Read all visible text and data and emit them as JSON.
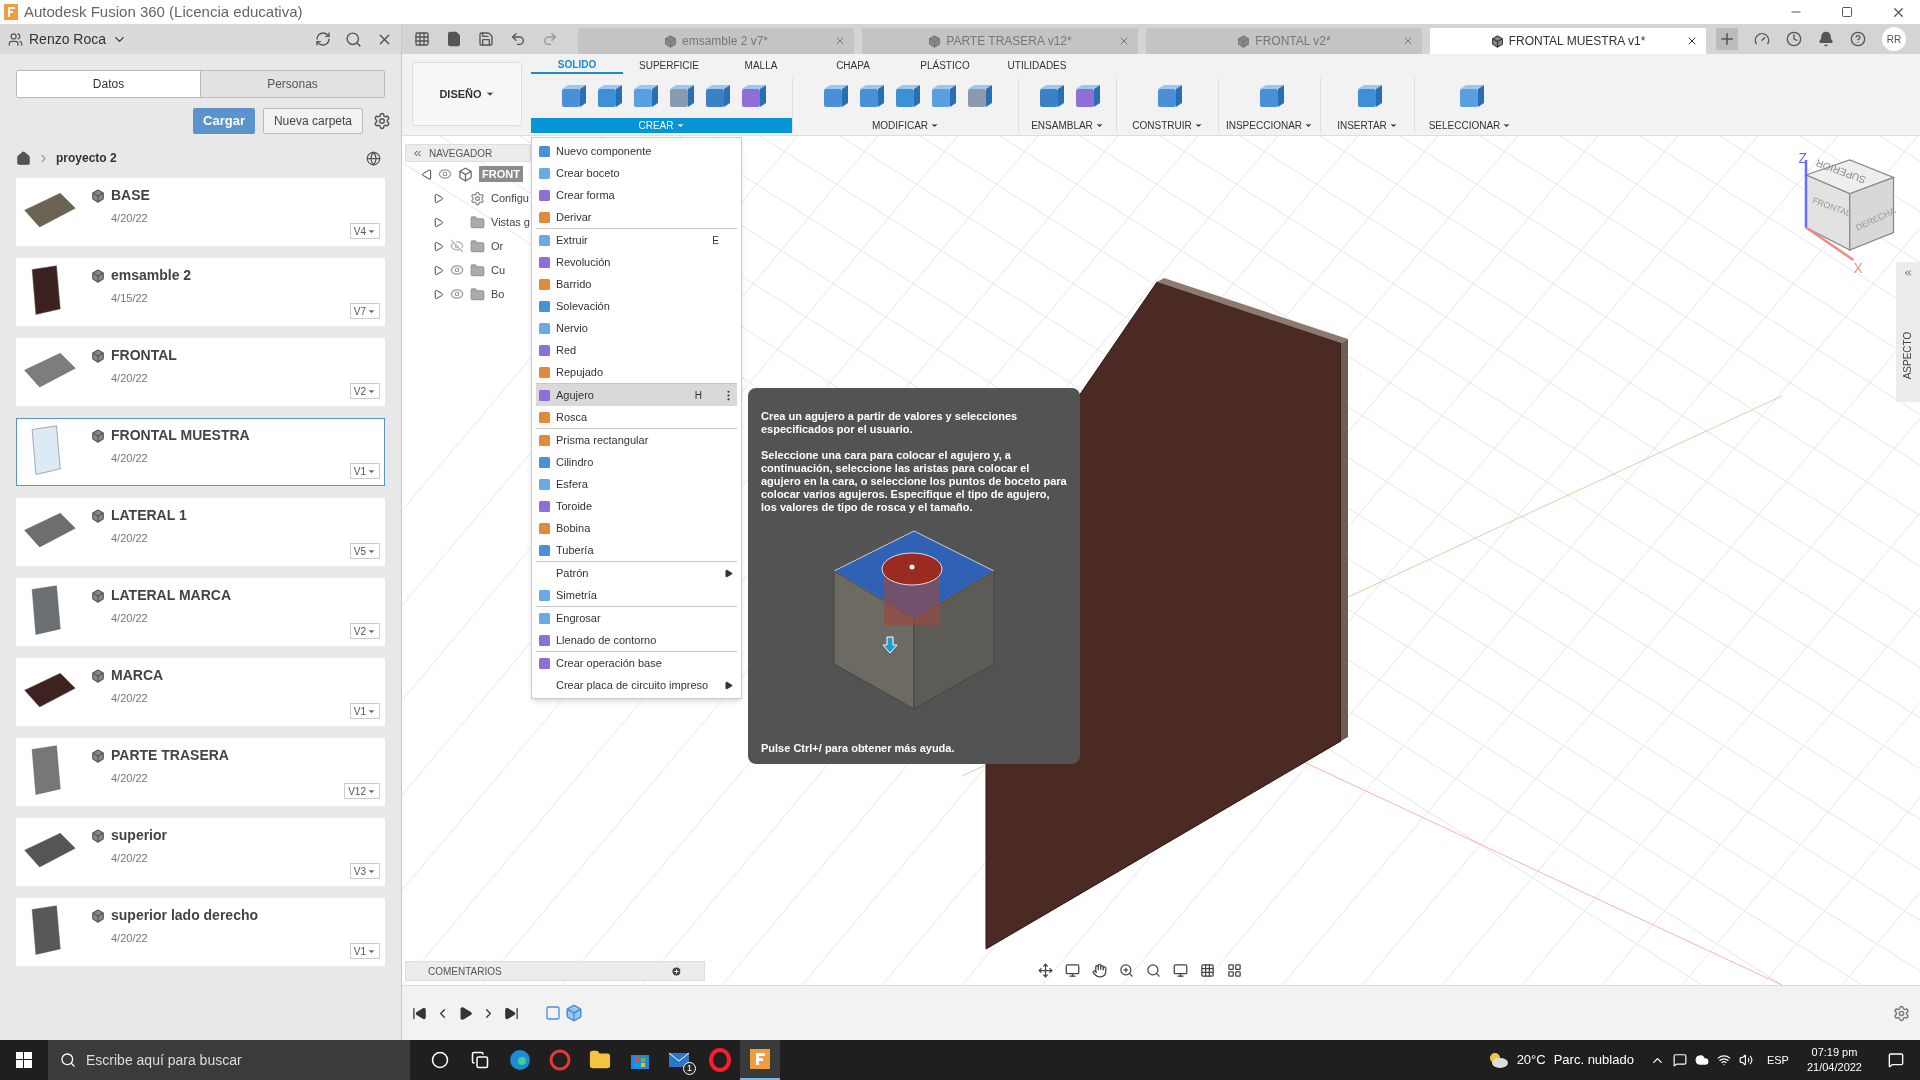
{
  "window": {
    "title": "Autodesk Fusion 360 (Licencia educativa)"
  },
  "data_panel": {
    "user": "Renzo Roca",
    "tabs": [
      {
        "label": "Datos",
        "selected": true
      },
      {
        "label": "Personas",
        "selected": false
      }
    ],
    "buttons": [
      {
        "label": "Cargar",
        "kind": "primary"
      },
      {
        "label": "Nueva carpeta",
        "kind": "secondary"
      }
    ],
    "breadcrumb": "proyecto 2",
    "files": [
      {
        "name": "BASE",
        "date": "4/20/22",
        "version": "V4",
        "selected": false,
        "color": "#6b6354"
      },
      {
        "name": "emsamble 2",
        "date": "4/15/22",
        "version": "V7",
        "selected": false,
        "color": "#3b2220"
      },
      {
        "name": "FRONTAL",
        "date": "4/20/22",
        "version": "V2",
        "selected": false,
        "color": "#7d7d7d"
      },
      {
        "name": "FRONTAL MUESTRA",
        "date": "4/20/22",
        "version": "V1",
        "selected": true,
        "color": "#dceaf5"
      },
      {
        "name": "LATERAL 1",
        "date": "4/20/22",
        "version": "V5",
        "selected": false,
        "color": "#6e6e6e"
      },
      {
        "name": "LATERAL MARCA",
        "date": "4/20/22",
        "version": "V2",
        "selected": false,
        "color": "#6a7074"
      },
      {
        "name": "MARCA",
        "date": "4/20/22",
        "version": "V1",
        "selected": false,
        "color": "#3d2220"
      },
      {
        "name": "PARTE TRASERA",
        "date": "4/20/22",
        "version": "V12",
        "selected": false,
        "color": "#777777"
      },
      {
        "name": "superior",
        "date": "4/20/22",
        "version": "V3",
        "selected": false,
        "color": "#555555"
      },
      {
        "name": "superior lado derecho",
        "date": "4/20/22",
        "version": "V1",
        "selected": false,
        "color": "#585858"
      }
    ]
  },
  "document_tabs": [
    {
      "label": "emsamble 2 v7*",
      "selected": false
    },
    {
      "label": "PARTE TRASERA v12*",
      "selected": false
    },
    {
      "label": "FRONTAL v2*",
      "selected": false
    },
    {
      "label": "FRONTAL MUESTRA v1*",
      "selected": true
    }
  ],
  "user_avatar": "RR",
  "toolbar": {
    "workspace": "DISEÑO",
    "tabs": [
      {
        "label": "SOLIDO",
        "selected": true
      },
      {
        "label": "SUPERFICIE",
        "selected": false
      },
      {
        "label": "MALLA",
        "selected": false
      },
      {
        "label": "CHAPA",
        "selected": false
      },
      {
        "label": "PLÁSTICO",
        "selected": false
      },
      {
        "label": "UTILIDADES",
        "selected": false
      }
    ],
    "groups": [
      {
        "label": "CREAR",
        "open": true
      },
      {
        "label": "MODIFICAR",
        "open": false
      },
      {
        "label": "ENSAMBLAR",
        "open": false
      },
      {
        "label": "CONSTRUIR",
        "open": false
      },
      {
        "label": "INSPECCIONAR",
        "open": false
      },
      {
        "label": "INSERTAR",
        "open": false
      },
      {
        "label": "SELECCIONAR",
        "open": false
      }
    ]
  },
  "navigator": {
    "title": "NAVEGADOR",
    "items": [
      {
        "label": "FRONT",
        "kind": "component",
        "visible": true,
        "expanded": true
      },
      {
        "label": "Configu",
        "kind": "settings",
        "expanded": false
      },
      {
        "label": "Vistas g",
        "kind": "folder",
        "expanded": false
      },
      {
        "label": "Or",
        "kind": "folder",
        "visible": false,
        "expanded": false
      },
      {
        "label": "Cu",
        "kind": "folder",
        "visible": true,
        "expanded": false
      },
      {
        "label": "Bo",
        "kind": "folder",
        "visible": true,
        "expanded": false
      }
    ]
  },
  "create_menu": {
    "sections": [
      [
        {
          "label": "Nuevo componente",
          "icon": true,
          "highlighted": false,
          "submenu": false
        },
        {
          "label": "Crear boceto",
          "icon": true,
          "highlighted": false,
          "submenu": false
        },
        {
          "label": "Crear forma",
          "icon": true,
          "highlighted": false,
          "submenu": false
        },
        {
          "label": "Derivar",
          "icon": true,
          "highlighted": false,
          "submenu": false
        }
      ],
      [
        {
          "label": "Extruir",
          "shortcut": "E",
          "icon": true,
          "highlighted": false,
          "submenu": false
        },
        {
          "label": "Revolución",
          "icon": true,
          "highlighted": false,
          "submenu": false
        },
        {
          "label": "Barrido",
          "icon": true,
          "highlighted": false,
          "submenu": false
        },
        {
          "label": "Solevación",
          "icon": true,
          "highlighted": false,
          "submenu": false
        },
        {
          "label": "Nervio",
          "icon": true,
          "highlighted": false,
          "submenu": false
        },
        {
          "label": "Red",
          "icon": true,
          "highlighted": false,
          "submenu": false
        },
        {
          "label": "Repujado",
          "icon": true,
          "highlighted": false,
          "submenu": false
        }
      ],
      [
        {
          "label": "Agujero",
          "shortcut": "H",
          "icon": true,
          "highlighted": true,
          "submenu": false
        },
        {
          "label": "Rosca",
          "icon": true,
          "highlighted": false,
          "submenu": false
        }
      ],
      [
        {
          "label": "Prisma rectangular",
          "icon": true,
          "highlighted": false,
          "submenu": false
        },
        {
          "label": "Cilindro",
          "icon": true,
          "highlighted": false,
          "submenu": false
        },
        {
          "label": "Esfera",
          "icon": true,
          "highlighted": false,
          "submenu": false
        },
        {
          "label": "Toroide",
          "icon": true,
          "highlighted": false,
          "submenu": false
        },
        {
          "label": "Bobina",
          "icon": true,
          "highlighted": false,
          "submenu": false
        },
        {
          "label": "Tubería",
          "icon": true,
          "highlighted": false,
          "submenu": false
        }
      ],
      [
        {
          "label": "Patrón",
          "icon": false,
          "highlighted": false,
          "submenu": true
        },
        {
          "label": "Simetría",
          "icon": true,
          "highlighted": false,
          "submenu": false
        }
      ],
      [
        {
          "label": "Engrosar",
          "icon": true,
          "highlighted": false,
          "submenu": false
        },
        {
          "label": "Llenado de contorno",
          "icon": true,
          "highlighted": false,
          "submenu": false
        }
      ],
      [
        {
          "label": "Crear operación base",
          "icon": true,
          "highlighted": false,
          "submenu": false
        },
        {
          "label": "Crear placa de circuito impreso",
          "icon": false,
          "highlighted": false,
          "submenu": true
        }
      ]
    ]
  },
  "tooltip": {
    "paragraphs": [
      "Crea un agujero a partir de valores y selecciones especificados por el usuario.",
      "Seleccione una cara para colocar el agujero y, a continuación, seleccione las aristas para colocar el agujero en la cara, o seleccione los puntos de boceto para colocar varios agujeros. Especifique el tipo de agujero, los valores de tipo de rosca y el tamaño."
    ],
    "footer": "Pulse Ctrl+/ para obtener más ayuda."
  },
  "viewcube": {
    "faces": [
      "SUPERIOR",
      "FRONTAL",
      "DERECHA"
    ],
    "axes": [
      "Z",
      "X"
    ]
  },
  "side_panel": "ASPECTO",
  "comments": "COMENTARIOS",
  "taskbar": {
    "search_placeholder": "Escribe aquí para buscar",
    "apps": [
      {
        "kind": "cortana",
        "active": false
      },
      {
        "kind": "taskview",
        "active": false
      },
      {
        "kind": "edge",
        "active": false
      },
      {
        "kind": "red",
        "active": false
      },
      {
        "kind": "explorer",
        "active": false
      },
      {
        "kind": "store",
        "active": false
      },
      {
        "kind": "mail",
        "active": false,
        "badge": "1"
      },
      {
        "kind": "opera",
        "active": false
      },
      {
        "kind": "fusion",
        "active": true
      }
    ],
    "temperature": "20°C",
    "weather": "Parc. nublado",
    "language": "ESP",
    "time": "07:19 pm",
    "date": "21/04/2022"
  }
}
